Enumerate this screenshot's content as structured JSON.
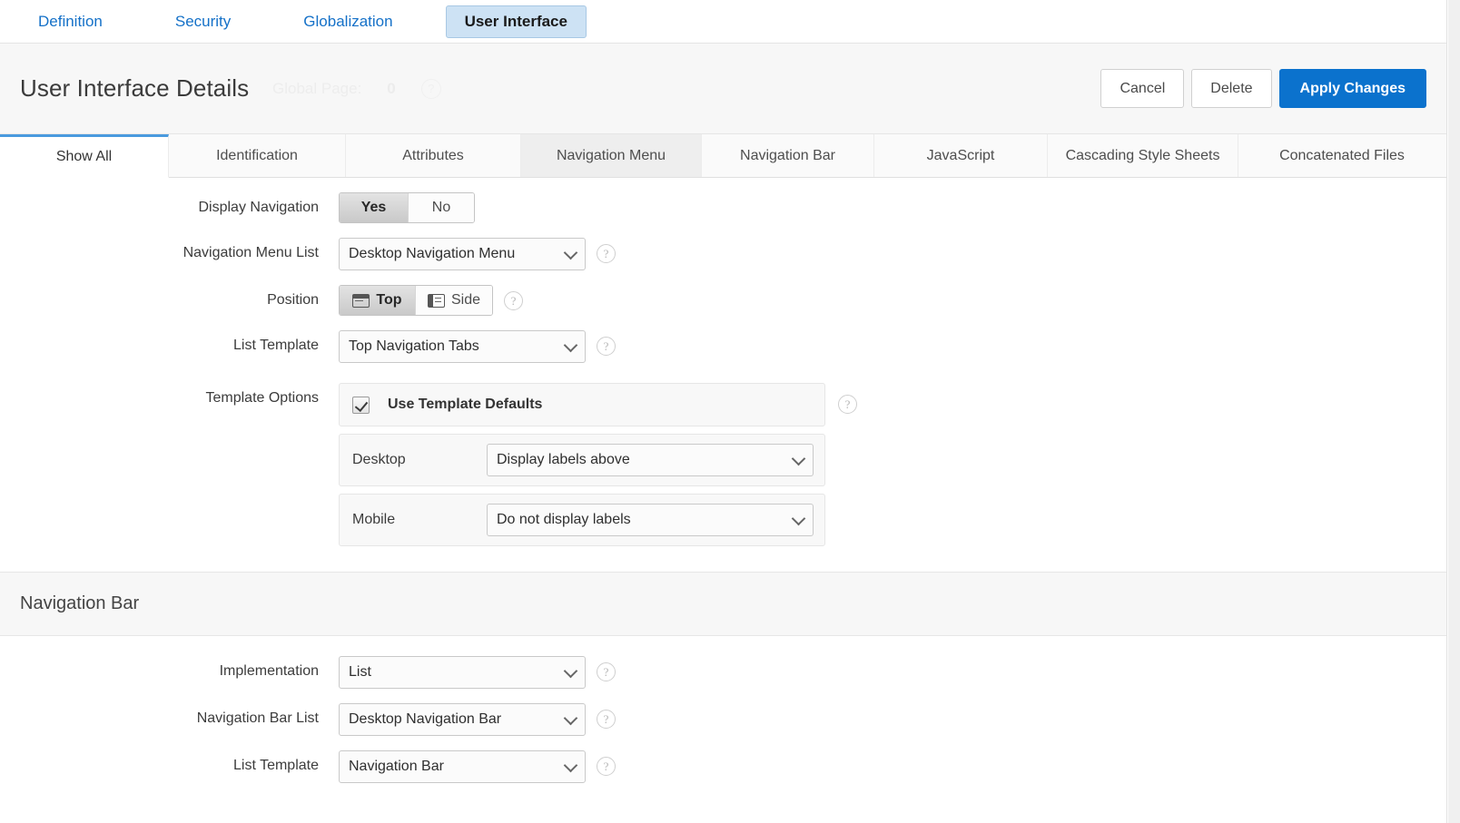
{
  "object_tabs": [
    {
      "label": "Definition",
      "active": false
    },
    {
      "label": "Security",
      "active": false
    },
    {
      "label": "Globalization",
      "active": false
    },
    {
      "label": "User Interface",
      "active": true
    }
  ],
  "header": {
    "title": "User Interface Details",
    "ghost_meta_label": "Global Page:",
    "ghost_meta_value": "0",
    "ghost_help_icon": "help-icon",
    "buttons": {
      "cancel": "Cancel",
      "delete": "Delete",
      "apply": "Apply Changes"
    },
    "accent_primary": "#0b72cd"
  },
  "subtabs": [
    {
      "label": "Show All",
      "state": "active"
    },
    {
      "label": "Identification",
      "state": "normal"
    },
    {
      "label": "Attributes",
      "state": "normal"
    },
    {
      "label": "Navigation Menu",
      "state": "hovered"
    },
    {
      "label": "Navigation Bar",
      "state": "normal"
    },
    {
      "label": "JavaScript",
      "state": "normal"
    },
    {
      "label": "Cascading Style Sheets",
      "state": "normal"
    },
    {
      "label": "Concatenated Files",
      "state": "normal"
    }
  ],
  "nav_menu": {
    "display_navigation": {
      "label": "Display Navigation",
      "options": [
        "Yes",
        "No"
      ],
      "selected": "Yes"
    },
    "navigation_menu_list": {
      "label": "Navigation Menu List",
      "value": "Desktop Navigation Menu",
      "help_icon": "help-icon"
    },
    "position": {
      "label": "Position",
      "options": [
        "Top",
        "Side"
      ],
      "selected": "Top",
      "help_icon": "help-icon",
      "top_icon": "layout-top-icon",
      "side_icon": "layout-side-icon"
    },
    "list_template": {
      "label": "List Template",
      "value": "Top Navigation Tabs",
      "help_icon": "help-icon"
    },
    "template_options": {
      "label": "Template Options",
      "use_defaults_label": "Use Template Defaults",
      "use_defaults_checked": true,
      "help_icon": "help-icon",
      "rows": [
        {
          "label": "Desktop",
          "value": "Display labels above"
        },
        {
          "label": "Mobile",
          "value": "Do not display labels"
        }
      ]
    }
  },
  "nav_bar": {
    "section_title": "Navigation Bar",
    "implementation": {
      "label": "Implementation",
      "value": "List",
      "help_icon": "help-icon"
    },
    "navigation_bar_list": {
      "label": "Navigation Bar List",
      "value": "Desktop Navigation Bar",
      "help_icon": "help-icon"
    },
    "list_template": {
      "label": "List Template",
      "value": "Navigation Bar",
      "help_icon": "help-icon"
    }
  }
}
